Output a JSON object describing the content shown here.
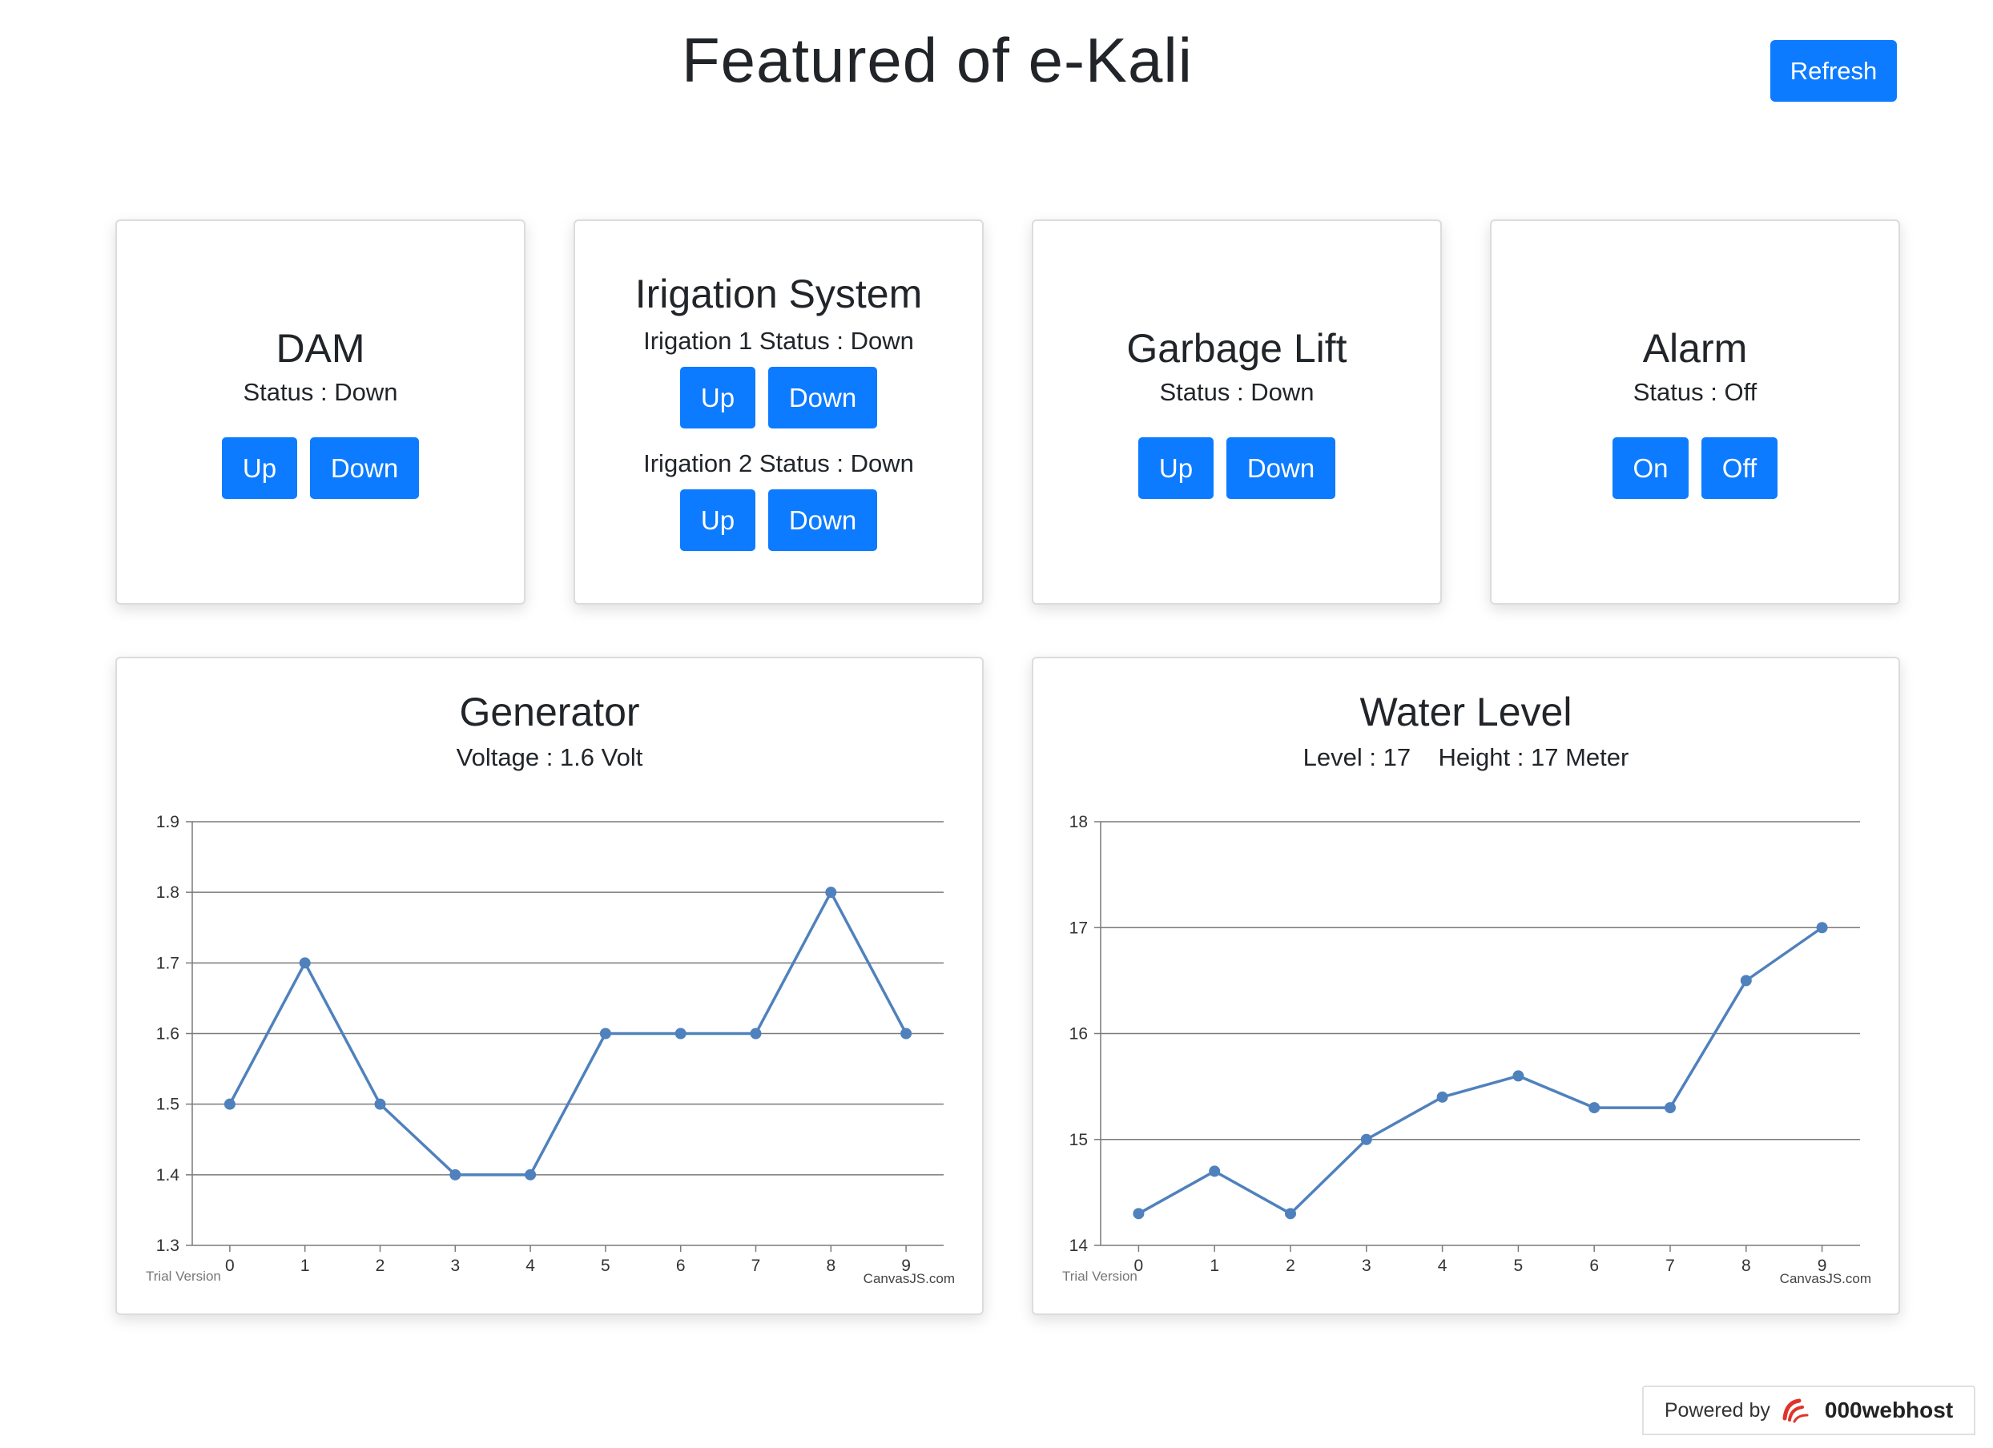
{
  "header": {
    "title": "Featured of e-Kali",
    "refresh_label": "Refresh"
  },
  "colors": {
    "primary_button": "#0d7bff",
    "chart_line": "#4f81bd"
  },
  "dam": {
    "title": "DAM",
    "status": "Status : Down",
    "up_label": "Up",
    "down_label": "Down"
  },
  "irrigation": {
    "title": "Irigation System",
    "status_1": "Irigation 1 Status : Down",
    "status_2": "Irigation 2 Status : Down",
    "up_label": "Up",
    "down_label": "Down"
  },
  "garbage": {
    "title": "Garbage Lift",
    "status": "Status : Down",
    "up_label": "Up",
    "down_label": "Down"
  },
  "alarm": {
    "title": "Alarm",
    "status": "Status : Off",
    "on_label": "On",
    "off_label": "Off"
  },
  "generator": {
    "title": "Generator",
    "subtitle": "Voltage : 1.6 Volt",
    "watermark_left": "Trial Version",
    "watermark_right": "CanvasJS.com"
  },
  "water": {
    "title": "Water Level",
    "level_text": "Level : 17",
    "height_text": "Height : 17 Meter",
    "watermark_left": "Trial Version",
    "watermark_right": "CanvasJS.com"
  },
  "chart_data": [
    {
      "type": "line",
      "x": [
        0,
        1,
        2,
        3,
        4,
        5,
        6,
        7,
        8,
        9
      ],
      "values": [
        1.5,
        1.7,
        1.5,
        1.4,
        1.4,
        1.6,
        1.6,
        1.6,
        1.8,
        1.6
      ],
      "ylim": [
        1.3,
        1.9
      ],
      "yticks": [
        "1.3",
        "1.4",
        "1.5",
        "1.6",
        "1.7",
        "1.8",
        "1.9"
      ],
      "xticks": [
        "0",
        "1",
        "2",
        "3",
        "4",
        "5",
        "6",
        "7",
        "8",
        "9"
      ],
      "grid": true
    },
    {
      "type": "line",
      "x": [
        0,
        1,
        2,
        3,
        4,
        5,
        6,
        7,
        8,
        9
      ],
      "values": [
        14.3,
        14.7,
        14.3,
        15,
        15.4,
        15.6,
        15.3,
        15.3,
        16.5,
        17
      ],
      "ylim": [
        14,
        18
      ],
      "yticks": [
        "14",
        "15",
        "16",
        "17",
        "18"
      ],
      "xticks": [
        "0",
        "1",
        "2",
        "3",
        "4",
        "5",
        "6",
        "7",
        "8",
        "9"
      ],
      "grid": true
    }
  ],
  "footer": {
    "powered_by": "Powered by",
    "brand": "000webhost"
  }
}
